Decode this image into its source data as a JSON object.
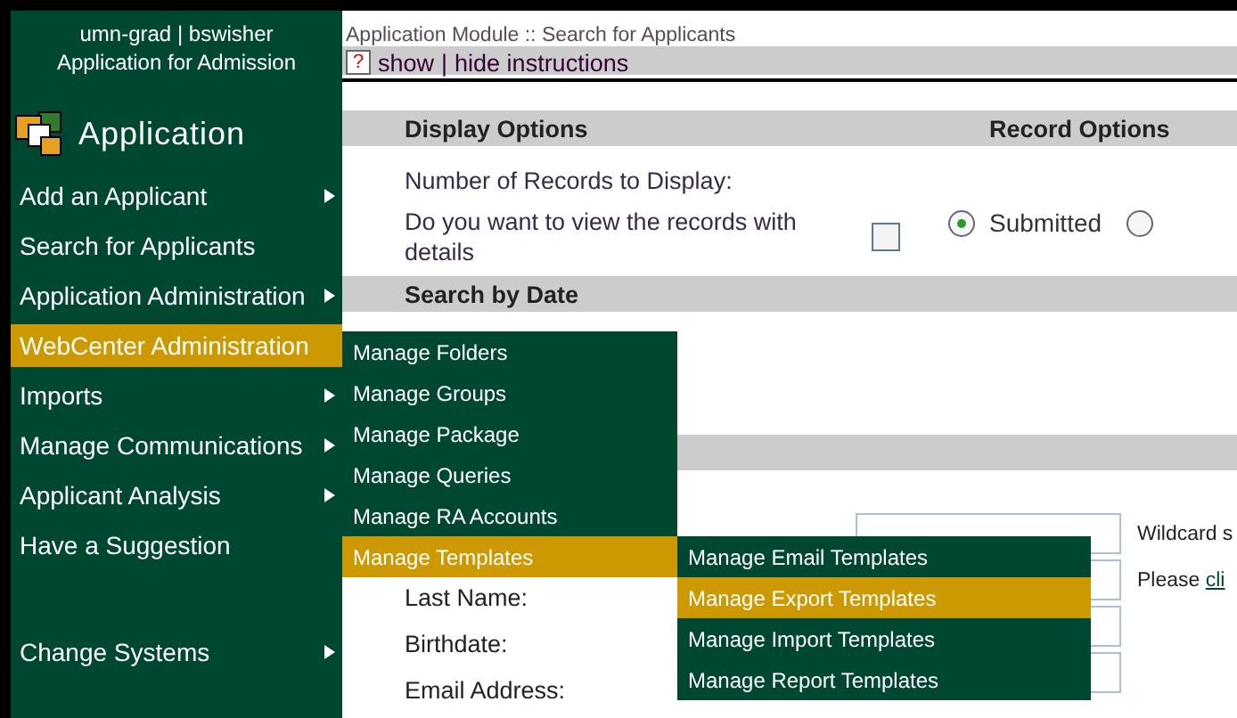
{
  "header": {
    "site": "umn-grad | bswisher",
    "system": "Application for Admission"
  },
  "app_title": "Application",
  "menu": [
    {
      "label": "Add an Applicant",
      "has_submenu": true,
      "selected": false
    },
    {
      "label": "Search for Applicants",
      "has_submenu": false,
      "selected": false
    },
    {
      "label": "Application Administration",
      "has_submenu": true,
      "selected": false
    },
    {
      "label": "WebCenter Administration",
      "has_submenu": false,
      "selected": true,
      "children": [
        {
          "label": "Manage Folders",
          "selected": false
        },
        {
          "label": "Manage Groups",
          "selected": false
        },
        {
          "label": "Manage Package",
          "selected": false
        },
        {
          "label": "Manage Queries",
          "selected": false
        },
        {
          "label": "Manage RA Accounts",
          "selected": false
        },
        {
          "label": "Manage Templates",
          "selected": true,
          "children": [
            {
              "label": "Manage Email Templates",
              "selected": false
            },
            {
              "label": "Manage Export Templates",
              "selected": true
            },
            {
              "label": "Manage Import Templates",
              "selected": false
            },
            {
              "label": "Manage Report Templates",
              "selected": false
            }
          ]
        }
      ]
    },
    {
      "label": "Imports",
      "has_submenu": true,
      "selected": false
    },
    {
      "label": "Manage Communications",
      "has_submenu": true,
      "selected": false
    },
    {
      "label": "Applicant Analysis",
      "has_submenu": true,
      "selected": false
    },
    {
      "label": "Have a Suggestion",
      "has_submenu": false,
      "selected": false
    },
    {
      "label": "Change Systems",
      "has_submenu": true,
      "selected": false,
      "kind": "separated"
    }
  ],
  "breadcrumb": "Application Module :: Search for Applicants",
  "instructions": {
    "icon": "?",
    "show": "show",
    "separator": "|",
    "hide": "hide instructions"
  },
  "display_options": {
    "title": "Display Options",
    "records_label": "Number of Records to Display:",
    "details_label": "Do you want to view the records with details",
    "details_checked": false
  },
  "record_options": {
    "title": "Record Options",
    "radios": [
      {
        "label": "Submitted",
        "selected": true
      },
      {
        "selected": false
      }
    ]
  },
  "search_by_date": {
    "title": "Search by Date"
  },
  "search_fields": [
    {
      "note": "Wildcard s"
    },
    {
      "label": "Last Name:",
      "note": "Please",
      "link": "cli"
    },
    {
      "label": "Birthdate:"
    },
    {
      "label": "Email Address:"
    }
  ]
}
